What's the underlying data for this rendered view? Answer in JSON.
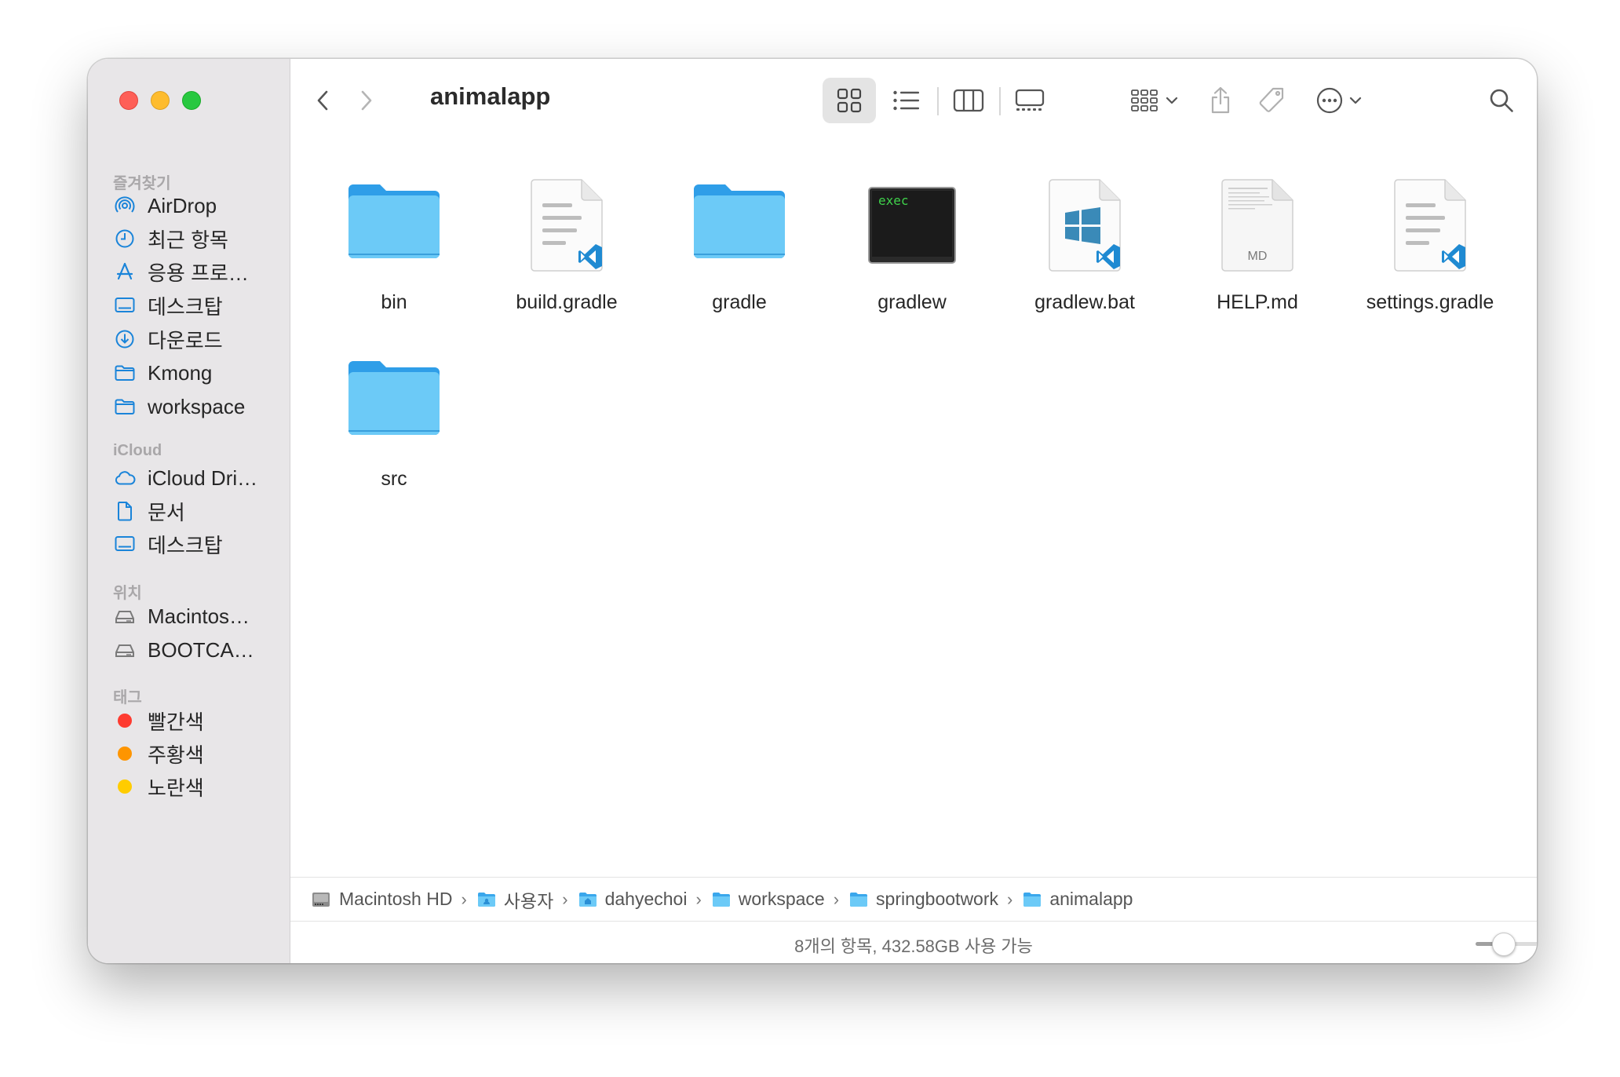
{
  "window": {
    "title": "animalapp"
  },
  "sidebar": {
    "favorites_title": "즐겨찾기",
    "favorites": [
      {
        "label": "AirDrop",
        "icon": "airdrop-icon"
      },
      {
        "label": "최근 항목",
        "icon": "clock-icon"
      },
      {
        "label": "응용 프로…",
        "icon": "applications-icon"
      },
      {
        "label": "데스크탑",
        "icon": "desktop-icon"
      },
      {
        "label": "다운로드",
        "icon": "download-icon"
      },
      {
        "label": "Kmong",
        "icon": "folder-icon"
      },
      {
        "label": "workspace",
        "icon": "folder-icon"
      }
    ],
    "icloud_title": "iCloud",
    "icloud": [
      {
        "label": "iCloud Dri…",
        "icon": "cloud-icon"
      },
      {
        "label": "문서",
        "icon": "document-icon"
      },
      {
        "label": "데스크탑",
        "icon": "desktop-icon"
      }
    ],
    "locations_title": "위치",
    "locations": [
      {
        "label": "Macintos…",
        "icon": "disk-icon"
      },
      {
        "label": "BOOTCA…",
        "icon": "disk-icon"
      }
    ],
    "tags_title": "태그",
    "tags": [
      {
        "label": "빨간색",
        "color": "#fe3b30"
      },
      {
        "label": "주황색",
        "color": "#fe9500"
      },
      {
        "label": "노란색",
        "color": "#ffcc00"
      }
    ]
  },
  "toolbar": {
    "view_modes": [
      "icon-view",
      "list-view",
      "column-view",
      "gallery-view"
    ],
    "active_view": "icon-view"
  },
  "files": [
    {
      "name": "bin",
      "type": "folder"
    },
    {
      "name": "build.gradle",
      "type": "vscode-doc"
    },
    {
      "name": "gradle",
      "type": "folder"
    },
    {
      "name": "gradlew",
      "type": "exec",
      "badge": "exec"
    },
    {
      "name": "gradlew.bat",
      "type": "windows-doc"
    },
    {
      "name": "HELP.md",
      "type": "markdown",
      "badge": "MD"
    },
    {
      "name": "settings.gradle",
      "type": "vscode-doc"
    },
    {
      "name": "src",
      "type": "folder"
    }
  ],
  "pathbar": [
    {
      "label": "Macintosh HD",
      "icon": "hard-drive-icon"
    },
    {
      "label": "사용자",
      "icon": "users-folder-icon"
    },
    {
      "label": "dahyechoi",
      "icon": "home-folder-icon"
    },
    {
      "label": "workspace",
      "icon": "folder-icon"
    },
    {
      "label": "springbootwork",
      "icon": "folder-icon"
    },
    {
      "label": "animalapp",
      "icon": "folder-icon"
    }
  ],
  "status": {
    "text": "8개의 항목, 432.58GB 사용 가능",
    "icon_size_fraction": 0.2
  },
  "colors": {
    "accent": "#1a84d9",
    "folder": "#6ccaf7",
    "sidebar_bg": "#e8e6e8"
  }
}
